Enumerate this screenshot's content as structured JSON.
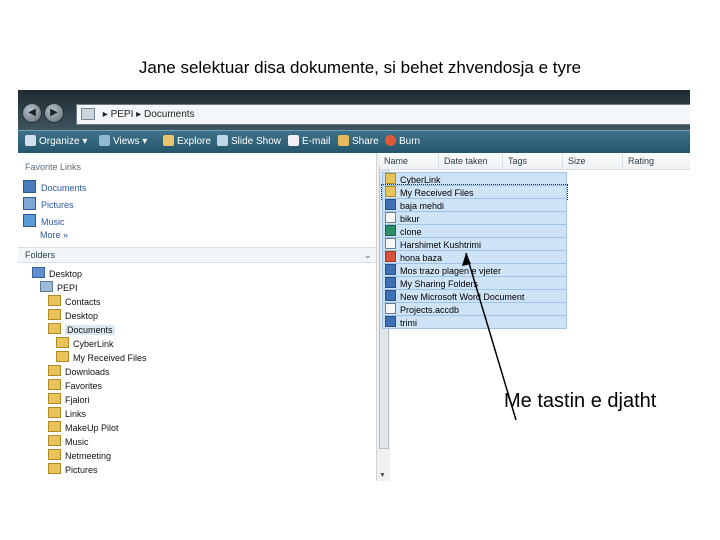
{
  "slide": {
    "title": "Jane selektuar disa dokumente, si behet zhvendosja e tyre"
  },
  "address": {
    "segments": [
      "PEPI",
      "Documents"
    ],
    "separators": [
      "▸",
      "▸"
    ]
  },
  "nav_buttons": {
    "back": "◀",
    "forward": "▶"
  },
  "toolbar": {
    "items": [
      {
        "label": "Organize",
        "icon": "organize-icon",
        "dropdown": "▾"
      },
      {
        "label": "Views",
        "icon": "views-icon",
        "dropdown": "▾"
      },
      {
        "label": "Explore",
        "icon": "explore-icon"
      },
      {
        "label": "Slide Show",
        "icon": "slideshow-icon"
      },
      {
        "label": "E-mail",
        "icon": "email-icon"
      },
      {
        "label": "Share",
        "icon": "share-icon"
      },
      {
        "label": "Burn",
        "icon": "burn-icon"
      }
    ]
  },
  "favorite_links": {
    "title": "Favorite Links",
    "items": [
      "Documents",
      "Pictures",
      "Music"
    ],
    "more": "More  »"
  },
  "folders": {
    "title": "Folders",
    "chevron": "⌄",
    "tree": [
      "Desktop",
      "PEPI",
      "Contacts",
      "Desktop",
      "Documents",
      "CyberLink",
      "My Received Files",
      "Downloads",
      "Favorites",
      "Fjalori",
      "Links",
      "MakeUp Pilot",
      "Music",
      "Netmeeting",
      "Pictures"
    ]
  },
  "columns": [
    "Name",
    "Date taken",
    "Tags",
    "Size",
    "Rating"
  ],
  "files": [
    "CyberLink",
    "My Received Files",
    "baja mehdi",
    "bikur",
    "clone",
    "Harshimet Kushtrimi",
    "hona baza",
    "Mos trazo plagen e vjeter",
    "My Sharing Folders",
    "New Microsoft Word Document",
    "Projects.accdb",
    "trimi"
  ],
  "callout": {
    "text": "Me tastin e djatht"
  },
  "colors": {
    "toolbar": "#2f6680",
    "selection": "#cfe3f6",
    "link": "#2a57a6"
  }
}
